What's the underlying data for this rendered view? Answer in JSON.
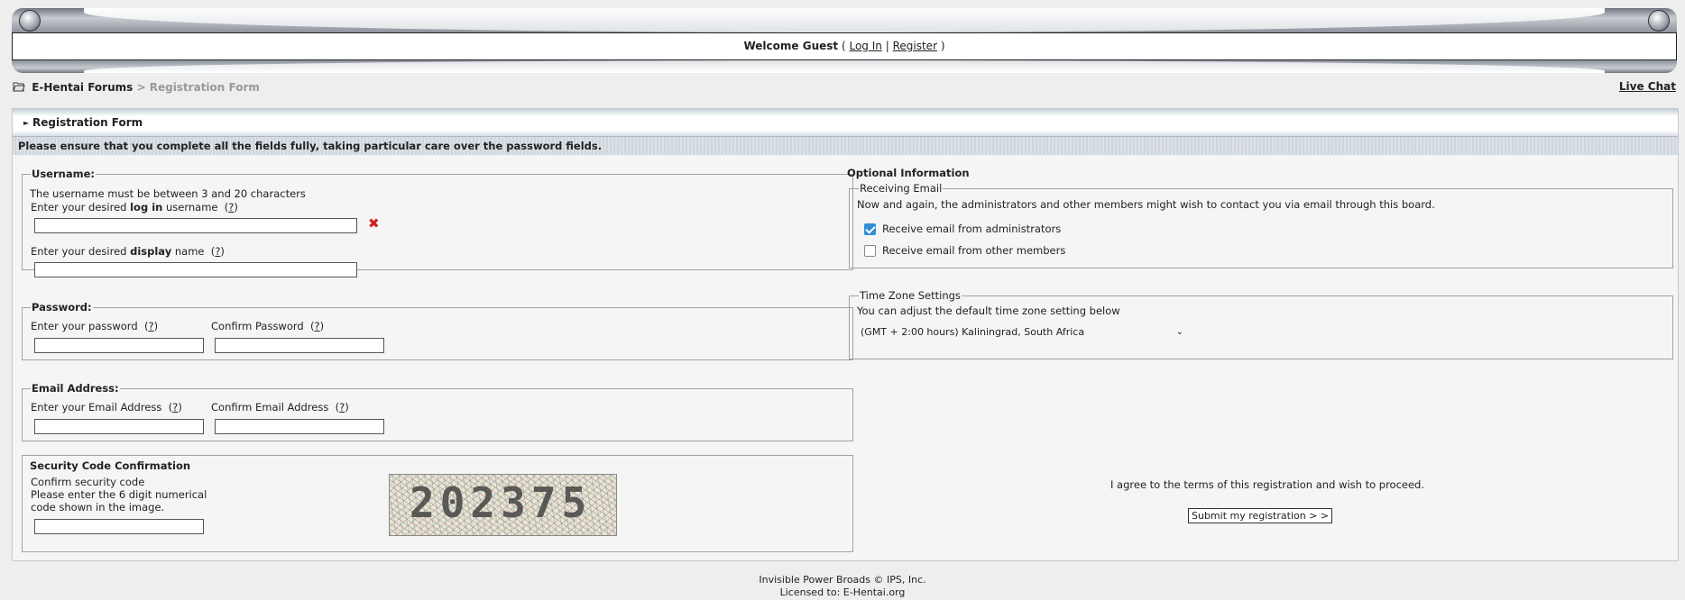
{
  "header": {
    "welcome": "Welcome Guest",
    "open_paren": "(",
    "login": "Log In",
    "divider": "|",
    "register": "Register",
    "close_paren": ")"
  },
  "nav": {
    "forum": "E-Hentai Forums",
    "separator": ">",
    "current": "Registration Form",
    "live_chat": "Live Chat"
  },
  "form": {
    "title": "Registration Form",
    "notice": "Please ensure that you complete all the fields fully, taking particular care over the password fields.",
    "help": "?",
    "username": {
      "legend": "Username:",
      "note": "The username must be between 3 and 20 characters",
      "login_prefix": "Enter your desired",
      "login_bold": "log in",
      "login_suffix": "username",
      "display_prefix": "Enter your desired",
      "display_bold": "display",
      "display_suffix": "name",
      "login_value": "",
      "display_value": ""
    },
    "password": {
      "legend": "Password:",
      "enter_label": "Enter your password",
      "confirm_label": "Confirm Password"
    },
    "email": {
      "legend": "Email Address:",
      "enter_label": "Enter your Email Address",
      "confirm_label": "Confirm Email Address"
    },
    "security": {
      "title": "Security Code Confirmation",
      "line1": "Confirm security code",
      "line2": "Please enter the 6 digit numerical",
      "line3": "code shown in the image.",
      "captcha_text": "202375"
    },
    "optional": {
      "title": "Optional Information",
      "receiving_legend": "Receiving Email",
      "receiving_desc": "Now and again, the administrators and other members might wish to contact you via email through this board.",
      "admin_label": "Receive email from administrators",
      "admin_checked": true,
      "members_label": "Receive email from other members",
      "members_checked": false,
      "tz_legend": "Time Zone Settings",
      "tz_desc": "You can adjust the default time zone setting below",
      "tz_value": "(GMT + 2:00 hours) Kaliningrad, South Africa"
    },
    "agree_text": "I agree to the terms of this registration and wish to proceed.",
    "submit_label": "Submit my registration > >"
  },
  "footer": {
    "line1": "Invisible Power Broads © IPS, Inc.",
    "line2": "Licensed to: E-Hentai.org"
  }
}
